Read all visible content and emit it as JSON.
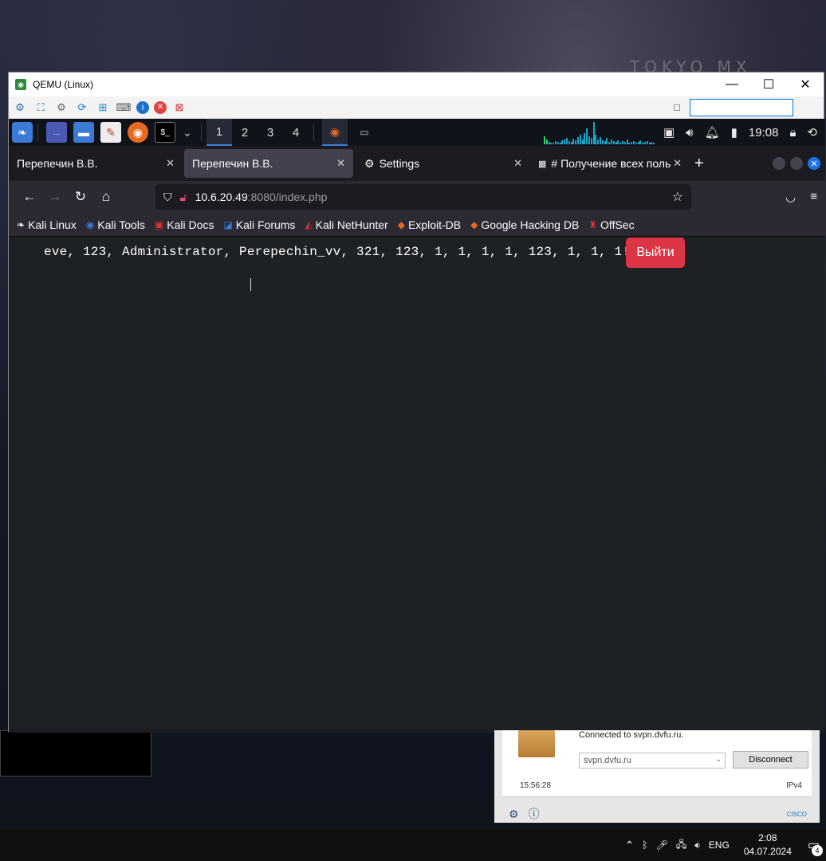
{
  "desktop": {
    "wallpaper_text": "TOKYO MX"
  },
  "qemu": {
    "title": "QEMU (Linux)",
    "controls": {
      "minimize": "—",
      "maximize": "☐",
      "close": "✕"
    }
  },
  "vm_panel": {
    "workspaces": [
      "1",
      "2",
      "3",
      "4"
    ],
    "clock": "19:08"
  },
  "firefox": {
    "tabs": [
      {
        "label": "Перепечин В.В."
      },
      {
        "label": "Перепечин В.В."
      },
      {
        "label": "Settings"
      },
      {
        "label": "# Получение всех польз"
      }
    ],
    "url_host": "10.6.20.49",
    "url_rest": ":8080/index.php",
    "bookmarks": [
      {
        "label": "Kali Linux"
      },
      {
        "label": "Kali Tools"
      },
      {
        "label": "Kali Docs"
      },
      {
        "label": "Kali Forums"
      },
      {
        "label": "Kali NetHunter"
      },
      {
        "label": "Exploit-DB"
      },
      {
        "label": "Google Hacking DB"
      },
      {
        "label": "OffSec"
      }
    ]
  },
  "page": {
    "text": "eve, 123, Administrator, Perepechin_vv, 321, 123, 1, 1, 1, 1, 123, 1, 1, 1!",
    "logout_label": "Выйти",
    "logout_color": "#dc3545"
  },
  "vpn": {
    "status": "Connected to svpn.dvfu.ru.",
    "server": "svpn.dvfu.ru",
    "disconnect_label": "Disconnect",
    "time": "15:56:28",
    "protocol": "IPv4",
    "brand": "CISCO"
  },
  "taskbar": {
    "lang": "ENG",
    "time": "2:08",
    "date": "04.07.2024",
    "notifications": "4"
  }
}
